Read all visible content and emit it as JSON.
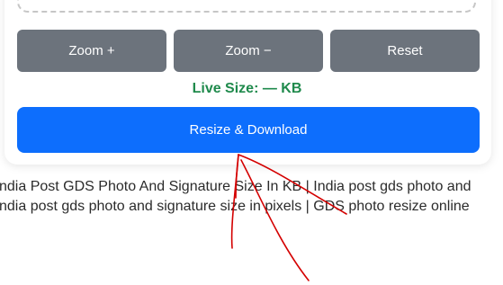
{
  "toolbar": {
    "zoom_in_label": "Zoom +",
    "zoom_out_label": "Zoom −",
    "reset_label": "Reset"
  },
  "status": {
    "live_size": "Live Size: — KB"
  },
  "actions": {
    "resize_download_label": "Resize & Download"
  },
  "article": {
    "line1": "ndia Post GDS Photo And Signature Size In KB | India post gds photo and",
    "line2": "ndia post gds photo and signature size in pixels | GDS photo resize online"
  },
  "colors": {
    "gray_button": "#6c737c",
    "primary_button": "#0d6efd",
    "live_size_text": "#1f8a4c",
    "annotation_arrow": "#d40000"
  }
}
